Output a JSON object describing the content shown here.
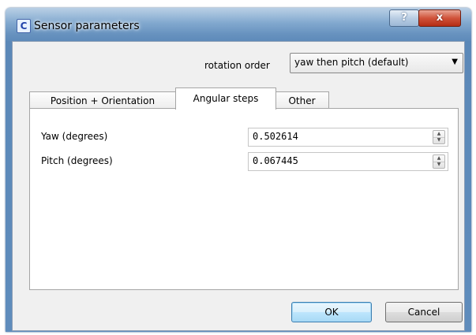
{
  "window": {
    "title": "Sensor parameters",
    "app_icon_glyph": "C",
    "help_label": "?",
    "close_label": "x"
  },
  "rotation": {
    "label": "rotation order",
    "selected": "yaw then pitch (default)",
    "arrow": "▼"
  },
  "tabs": [
    {
      "label": "Position + Orientation",
      "active": false
    },
    {
      "label": "Angular steps",
      "active": true
    },
    {
      "label": "Other",
      "active": false
    }
  ],
  "fields": [
    {
      "label": "Yaw (degrees)",
      "value": "0.502614"
    },
    {
      "label": "Pitch (degrees)",
      "value": "0.067445"
    }
  ],
  "buttons": {
    "ok": "OK",
    "cancel": "Cancel"
  },
  "icons": {
    "spin_up": "▲",
    "spin_down": "▼"
  }
}
